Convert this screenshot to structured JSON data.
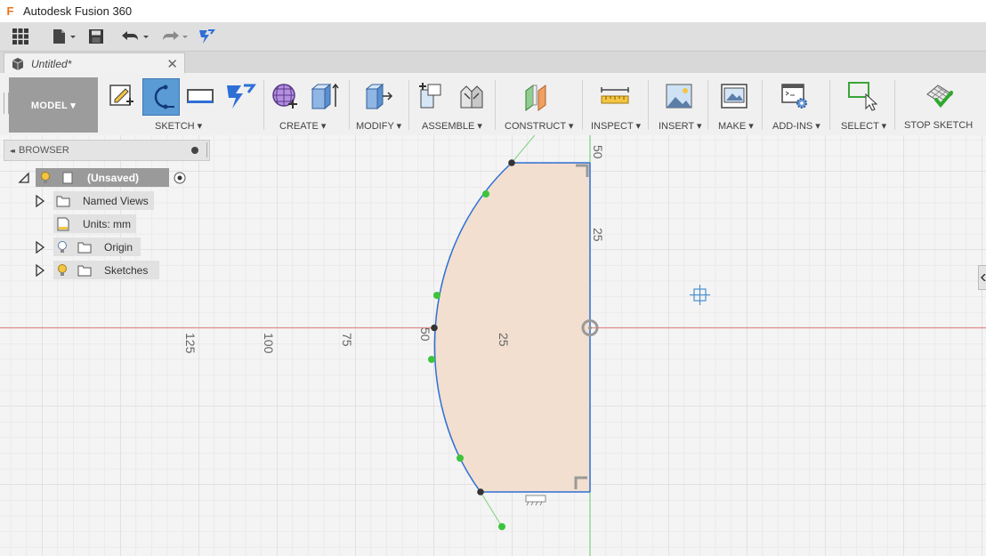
{
  "app": {
    "title": "Autodesk Fusion 360",
    "logo_letter": "F"
  },
  "document": {
    "tab_title": "Untitled*",
    "close_glyph": "✕"
  },
  "workspace": {
    "label": "MODEL ▾"
  },
  "ribbon": {
    "groups": {
      "sketch": "SKETCH ▾",
      "create": "CREATE ▾",
      "modify": "MODIFY ▾",
      "assemble": "ASSEMBLE ▾",
      "construct": "CONSTRUCT ▾",
      "inspect": "INSPECT ▾",
      "insert": "INSERT ▾",
      "make": "MAKE ▾",
      "addins": "ADD-INS ▾",
      "select": "SELECT ▾",
      "stop_sketch": "STOP SKETCH"
    }
  },
  "browser": {
    "title": "BROWSER",
    "collapse_glyph": "◂◂",
    "root": "(Unsaved)",
    "items": [
      {
        "label": "Named Views"
      },
      {
        "label": "Units: mm"
      },
      {
        "label": "Origin"
      },
      {
        "label": "Sketches"
      }
    ]
  },
  "canvas": {
    "h_ticks": [
      "125",
      "100",
      "75",
      "50",
      "25"
    ],
    "v_ticks": [
      "50",
      "25"
    ]
  },
  "colors": {
    "accent": "#2e6fd6",
    "profile_fill": "#f2dfcf",
    "x_axis": "#e08a8a",
    "y_axis": "#7fd07f",
    "constraint_point": "#3cc43c"
  }
}
